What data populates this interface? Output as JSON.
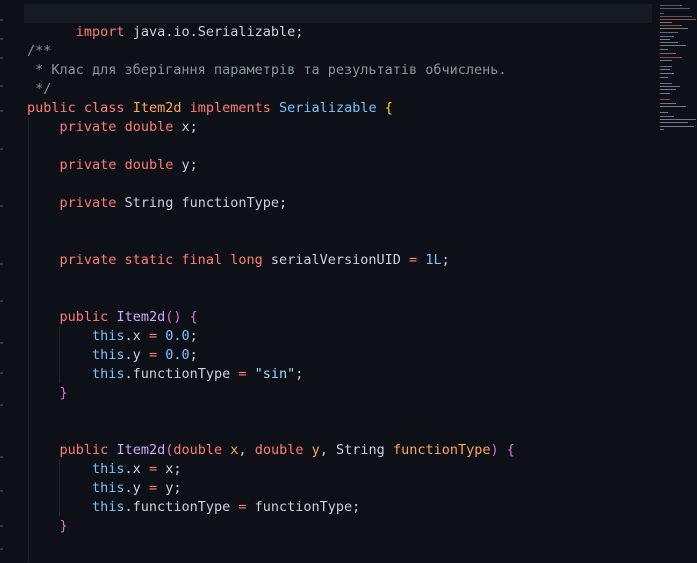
{
  "editor": {
    "language": "java",
    "theme": "dark",
    "lines": {
      "import": {
        "kw": "import",
        "pkg": " java.io.Serializable;"
      },
      "doc_open": "/**",
      "doc_text": " * Клас для зберігання параметрів та результатів обчислень.",
      "doc_close": " */",
      "class_decl": {
        "mod": "public",
        "kw_class": "class",
        "name": "Item2d",
        "kw_impl": "implements",
        "iface": "Serializable",
        "brace": "{"
      },
      "field_x": {
        "mod": "private",
        "type": "double",
        "name": " x;"
      },
      "field_y": {
        "mod": "private",
        "type": "double",
        "name": " y;"
      },
      "field_ft": {
        "mod": "private",
        "type": " String",
        "name": " functionType;"
      },
      "field_uid": {
        "mods": "private static final",
        "type": "long",
        "name": " serialVersionUID ",
        "op": "=",
        "value": "1L",
        "semi": ";"
      },
      "ctor1": {
        "mod": "public",
        "name": "Item2d",
        "parens": "()",
        "brace": "{"
      },
      "ctor1_x": {
        "this": "this",
        "rest": ".x ",
        "op": "=",
        "value": "0.0",
        "semi": ";"
      },
      "ctor1_y": {
        "this": "this",
        "rest": ".y ",
        "op": "=",
        "value": "0.0",
        "semi": ";"
      },
      "ctor1_ft": {
        "this": "this",
        "rest": ".functionType ",
        "op": "=",
        "value": "\"sin\"",
        "semi": ";"
      },
      "ctor1_close": "}",
      "ctor2": {
        "mod": "public",
        "name": "Item2d",
        "open": "(",
        "t1": "double",
        "p1": "x",
        "t2": "double",
        "p2": "y",
        "t3": "String",
        "p3": "functionType",
        "close": ")",
        "brace": "{"
      },
      "ctor2_x": {
        "this": "this",
        "rest": ".x ",
        "op": "=",
        "value": "x",
        "semi": ";"
      },
      "ctor2_y": {
        "this": "this",
        "rest": ".y ",
        "op": "=",
        "value": "y",
        "semi": ";"
      },
      "ctor2_ft": {
        "this": "this",
        "rest": ".functionType ",
        "op": "=",
        "value": "functionType",
        "semi": ";"
      },
      "ctor2_close": "}"
    }
  }
}
